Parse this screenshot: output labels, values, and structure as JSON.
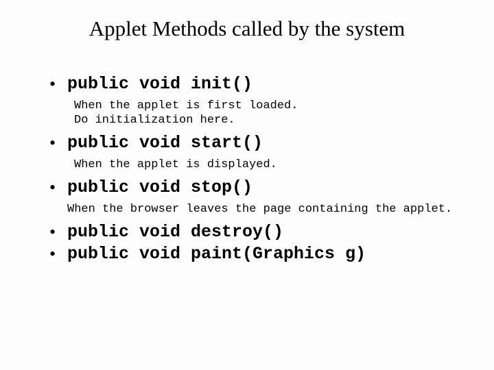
{
  "title": "Applet Methods called by the system",
  "items": [
    {
      "method": "public void init()",
      "desc": "When the applet is first loaded.\nDo initialization here."
    },
    {
      "method": "public void start()",
      "desc": "When the applet is displayed."
    },
    {
      "method": "public void stop()",
      "desc": "When the browser leaves the page containing the applet."
    },
    {
      "method": "public void destroy()",
      "desc": null
    },
    {
      "method": "public void paint(Graphics g)",
      "desc": null
    }
  ]
}
